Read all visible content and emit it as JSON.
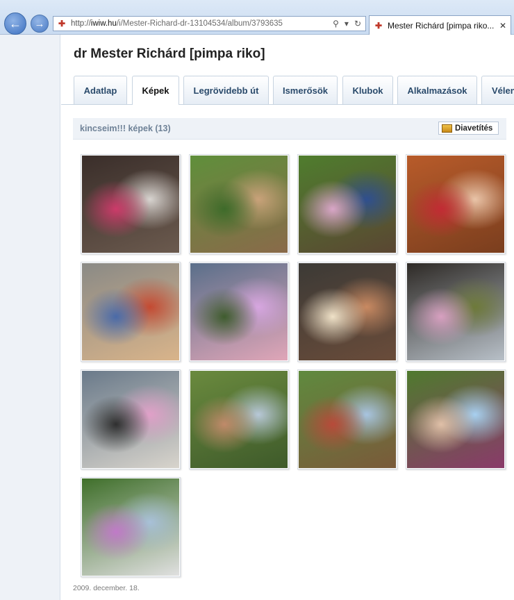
{
  "browser": {
    "url_scheme": "http://",
    "url_host": "iwiw.hu",
    "url_path": "/i/Mester-Richard-dr-13104534/album/3793635",
    "tab_title": "Mester Richárd [pimpa riko...",
    "icons": {
      "back": "back-arrow-icon",
      "forward": "forward-arrow-icon",
      "search": "search-icon",
      "refresh": "refresh-icon",
      "close": "close-icon"
    }
  },
  "profile": {
    "name": "dr Mester Richárd [pimpa riko]"
  },
  "tabs": [
    {
      "label": "Adatlap",
      "active": false
    },
    {
      "label": "Képek",
      "active": true
    },
    {
      "label": "Legrövidebb út",
      "active": false
    },
    {
      "label": "Ismerősök",
      "active": false
    },
    {
      "label": "Klubok",
      "active": false
    },
    {
      "label": "Alkalmazások",
      "active": false
    },
    {
      "label": "Vélen",
      "active": false
    }
  ],
  "album": {
    "title": "kincseim!!! képek (13)",
    "slideshow_label": "Diavetítés",
    "photo_count": 13
  },
  "photos": [
    {
      "colors": [
        "#3a2e2a",
        "#d8d4d0",
        "#cc3b6a",
        "#6b5a4e"
      ]
    },
    {
      "colors": [
        "#5f8f3b",
        "#c9a27a",
        "#3e6b2a",
        "#8a6a4a"
      ]
    },
    {
      "colors": [
        "#4f7d2e",
        "#2f4f8f",
        "#d9a6c8",
        "#5a4632"
      ]
    },
    {
      "colors": [
        "#b85b2a",
        "#e9c4a8",
        "#c22b34",
        "#7a3e1e"
      ]
    },
    {
      "colors": [
        "#8a8a86",
        "#c44a32",
        "#4a6aa8",
        "#d9b48a"
      ]
    },
    {
      "colors": [
        "#5a6f8a",
        "#d7a6e0",
        "#3f5c2e",
        "#e0a6b8"
      ]
    },
    {
      "colors": [
        "#3c3a36",
        "#c98a62",
        "#f0e2c8",
        "#6a4c3a"
      ]
    },
    {
      "colors": [
        "#2e2a26",
        "#6e7a3a",
        "#d7a0c0",
        "#b8c0c8"
      ]
    },
    {
      "colors": [
        "#6a7a8a",
        "#e0a0c8",
        "#2f2f2f",
        "#d8d4cc"
      ]
    },
    {
      "colors": [
        "#6a8a3e",
        "#b8c8d8",
        "#c08a6a",
        "#3e5a2a"
      ]
    },
    {
      "colors": [
        "#5f8a3e",
        "#a8c4e0",
        "#b84a3a",
        "#7a5a3a"
      ]
    },
    {
      "colors": [
        "#4f7a2e",
        "#a8d0f0",
        "#e0c0a8",
        "#8a3a6a"
      ]
    },
    {
      "colors": [
        "#3f6f2a",
        "#a8c0d8",
        "#c07ac8",
        "#e0e0e0"
      ]
    }
  ],
  "footer": {
    "date": "2009. december. 18."
  }
}
